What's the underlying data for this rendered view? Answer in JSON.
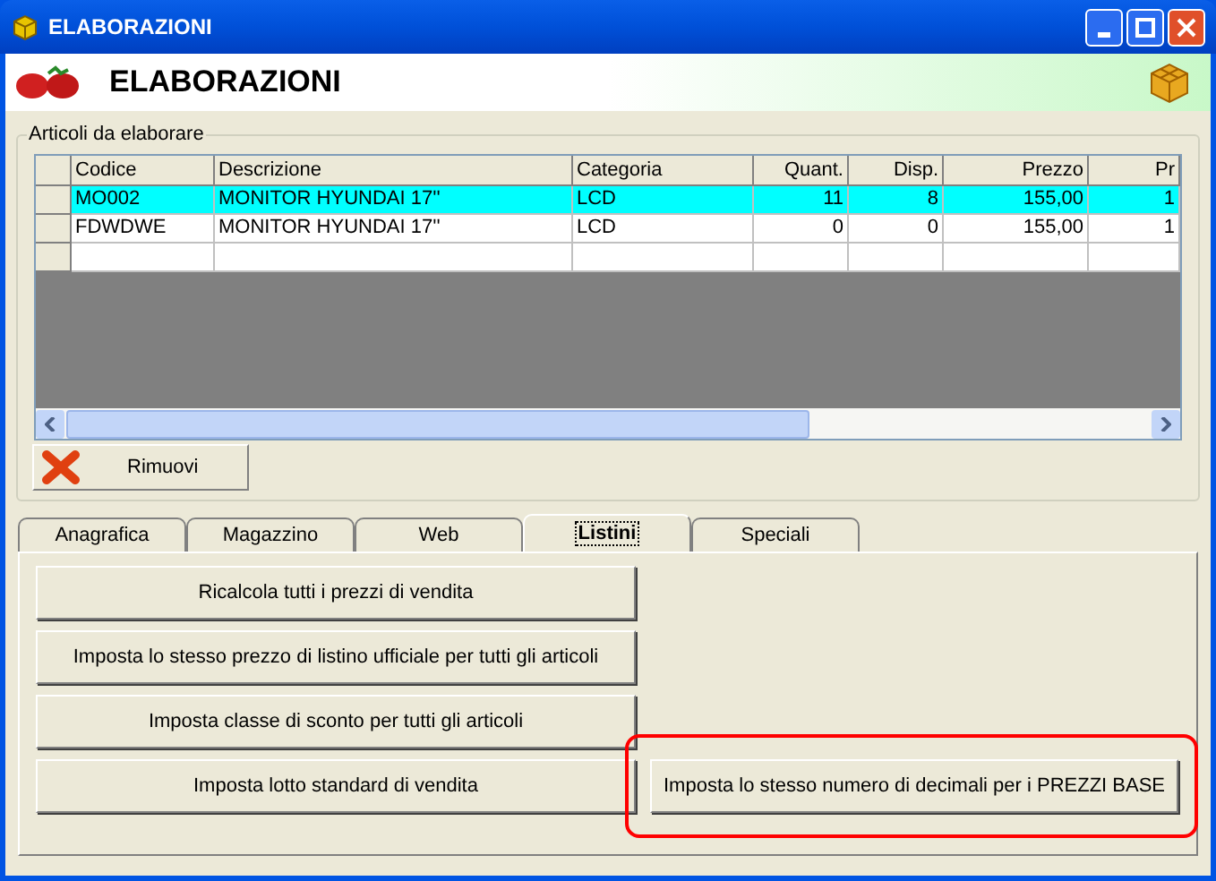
{
  "window": {
    "title": "ELABORAZIONI"
  },
  "header": {
    "title": "ELABORAZIONI"
  },
  "group": {
    "title": "Articoli da elaborare"
  },
  "table": {
    "columns": [
      {
        "label": "Codice",
        "kind": "text"
      },
      {
        "label": "Descrizione",
        "kind": "text"
      },
      {
        "label": "Categoria",
        "kind": "text"
      },
      {
        "label": "Quant.",
        "kind": "number"
      },
      {
        "label": "Disp.",
        "kind": "number"
      },
      {
        "label": "Prezzo",
        "kind": "number"
      },
      {
        "label": "Pr",
        "kind": "number"
      }
    ],
    "rows": [
      {
        "selected": true,
        "cells": [
          "MO002",
          "MONITOR HYUNDAI 17''",
          "LCD",
          "11",
          "8",
          "155,00",
          "1"
        ]
      },
      {
        "selected": false,
        "cells": [
          "FDWDWE",
          "MONITOR HYUNDAI 17''",
          "LCD",
          "0",
          "0",
          "155,00",
          "1"
        ]
      }
    ]
  },
  "remove_button": "Rimuovi",
  "tabs": [
    {
      "label": "Anagrafica",
      "selected": false
    },
    {
      "label": "Magazzino",
      "selected": false
    },
    {
      "label": "Web",
      "selected": false
    },
    {
      "label": "Listini",
      "selected": true
    },
    {
      "label": "Speciali",
      "selected": false
    }
  ],
  "actions": [
    {
      "label": "Ricalcola tutti i prezzi di vendita",
      "highlighted": false
    },
    {
      "label": "Imposta lo stesso prezzo di listino ufficiale per tutti gli articoli",
      "highlighted": false
    },
    {
      "label": "Imposta classe di sconto per tutti gli articoli",
      "highlighted": false
    },
    {
      "label": "Imposta lotto standard di vendita",
      "highlighted": false
    },
    {
      "label": "Imposta lo stesso numero di decimali per i PREZZI BASE",
      "highlighted": true
    }
  ]
}
